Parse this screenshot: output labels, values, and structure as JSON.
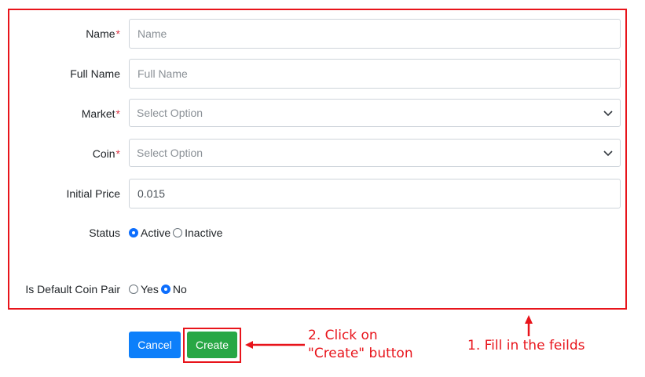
{
  "form": {
    "fields": {
      "name": {
        "label": "Name",
        "required_mark": "*",
        "placeholder": "Name"
      },
      "full_name": {
        "label": "Full Name",
        "placeholder": "Full Name"
      },
      "market": {
        "label": "Market",
        "required_mark": "*",
        "placeholder": "Select Option"
      },
      "coin": {
        "label": "Coin",
        "required_mark": "*",
        "placeholder": "Select Option"
      },
      "initial_price": {
        "label": "Initial Price",
        "value": "0.015"
      },
      "status": {
        "label": "Status",
        "options": [
          "Active",
          "Inactive"
        ],
        "selected": "Active"
      },
      "is_default": {
        "label": "Is Default Coin Pair",
        "options": [
          "Yes",
          "No"
        ],
        "selected": "No"
      }
    },
    "buttons": {
      "cancel_label": "Cancel",
      "create_label": "Create"
    }
  },
  "annotations": {
    "step2_line1": "2. Click on",
    "step2_line2": "\"Create\" button",
    "step1": "1. Fill in the feilds",
    "highlight_color": "#e8141b"
  },
  "colors": {
    "primary": "#0d7ffa",
    "success": "#28a745",
    "required": "#dc3545"
  }
}
